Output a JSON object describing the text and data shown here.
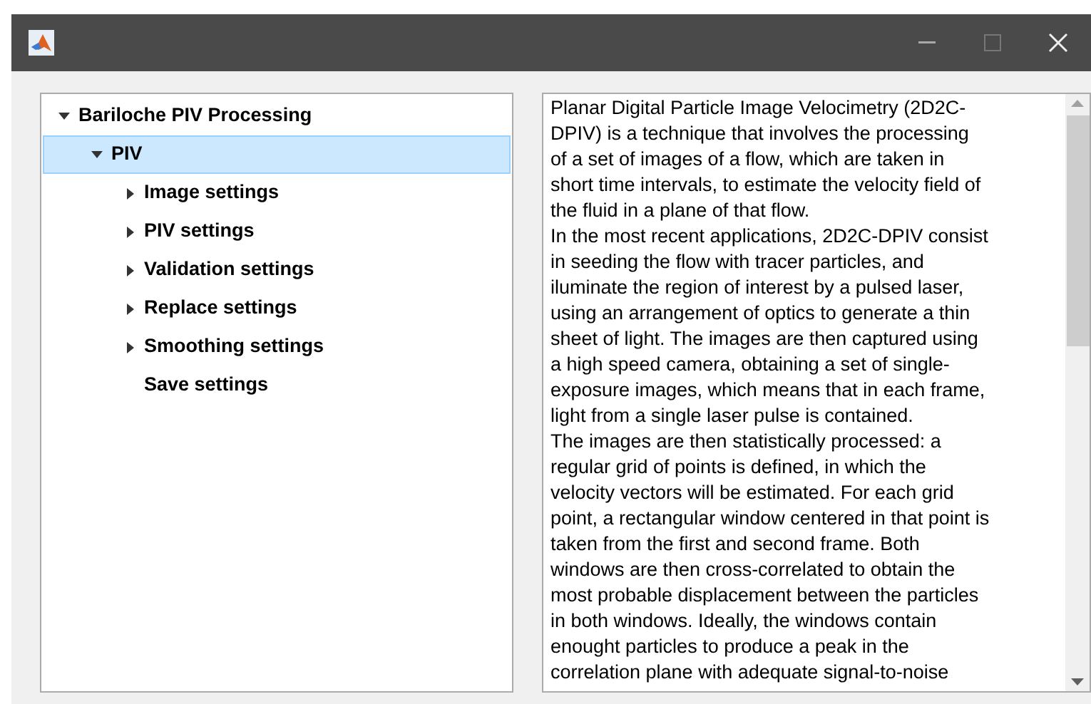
{
  "window": {
    "title_controls": [
      {
        "kind": "minimize"
      },
      {
        "kind": "maximize"
      },
      {
        "kind": "close"
      }
    ]
  },
  "tree": [
    {
      "label": "Bariloche PIV Processing",
      "kind": "node",
      "expanded": true,
      "selected": false,
      "children": [
        {
          "label": "PIV",
          "kind": "node",
          "expanded": true,
          "selected": true,
          "children": [
            {
              "label": "Image settings",
              "kind": "node",
              "expanded": false,
              "selected": false
            },
            {
              "label": "PIV settings",
              "kind": "node",
              "expanded": false,
              "selected": false
            },
            {
              "label": "Validation settings",
              "kind": "node",
              "expanded": false,
              "selected": false
            },
            {
              "label": "Replace settings",
              "kind": "node",
              "expanded": false,
              "selected": false
            },
            {
              "label": "Smoothing settings",
              "kind": "node",
              "expanded": false,
              "selected": false
            },
            {
              "label": "Save settings",
              "kind": "leaf",
              "expanded": false,
              "selected": false
            }
          ]
        }
      ]
    }
  ],
  "description": {
    "lines": [
      "Planar Digital Particle Image Velocimetry (2D2C-",
      "DPIV) is a technique that involves the processing",
      "of a set of images of a flow, which are taken in",
      "short time intervals, to estimate the velocity field of",
      "the fluid in a plane of that flow.",
      "In the most recent applications, 2D2C-DPIV consist",
      "in seeding the flow with tracer particles, and",
      "iluminate the region of interest by a pulsed laser,",
      "using an arrangement of optics to generate a thin",
      "sheet of light. The images are then captured using",
      "a high speed camera, obtaining a set of single-",
      "exposure images, which means that in each frame,",
      "light from a single laser pulse is contained.",
      "The images are then statistically processed: a",
      "regular grid of points is defined, in which the",
      "velocity vectors will be estimated. For each grid",
      "point, a rectangular window centered in that point is",
      "taken from the first and second frame. Both",
      "windows are then cross-correlated to obtain the",
      "most probable displacement between the particles",
      "in both windows. Ideally, the windows contain",
      "enought particles to produce a peak in the",
      "correlation plane with adequate signal-to-noise"
    ]
  }
}
